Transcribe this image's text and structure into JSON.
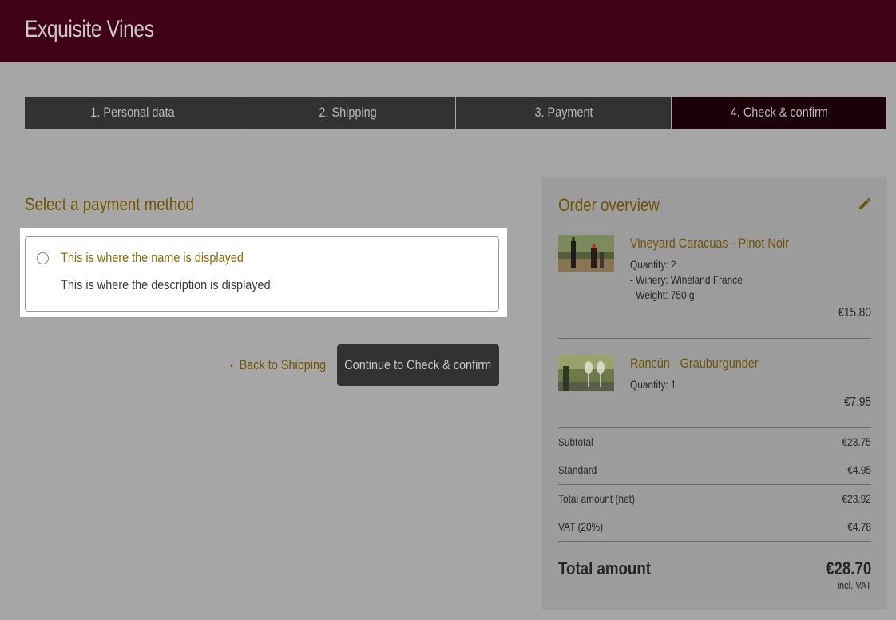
{
  "header": {
    "brand": "Exquisite Vines"
  },
  "steps": [
    {
      "label": "1. Personal data"
    },
    {
      "label": "2. Shipping"
    },
    {
      "label": "3. Payment"
    },
    {
      "label": "4. Check & confirm"
    }
  ],
  "payment": {
    "title": "Select a payment method",
    "option": {
      "name": "This is where the name is displayed",
      "description": "This is where the description is displayed"
    },
    "back_label": "Back to Shipping",
    "continue_label": "Continue to Check & confirm"
  },
  "overview": {
    "title": "Order overview",
    "items": [
      {
        "name": "Vineyard Caracuas - Pinot Noir",
        "quantity": "Quantity: 2",
        "winery": "- Winery: Wineland France",
        "weight": "- Weight: 750 g",
        "price": "€15.80"
      },
      {
        "name": "Rancún - Grauburgunder",
        "quantity": "Quantity: 1",
        "price": "€7.95"
      }
    ],
    "summary": [
      {
        "label": "Subtotal",
        "value": "€23.75"
      },
      {
        "label": "Standard",
        "value": "€4.95"
      },
      {
        "label": "Total amount (net)",
        "value": "€23.92"
      },
      {
        "label": "VAT (20%)",
        "value": "€4.78"
      }
    ],
    "total": {
      "label": "Total amount",
      "value": "€28.70",
      "note": "incl. VAT"
    }
  },
  "colors": {
    "header_bg": "#3f0218",
    "accent_text": "#6e5300",
    "active_step_bg": "#1c0009",
    "button_bg": "#323232"
  }
}
